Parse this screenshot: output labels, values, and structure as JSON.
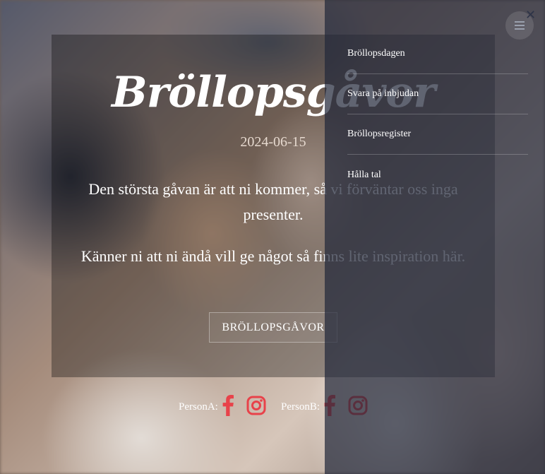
{
  "hero": {
    "title": "Bröllopsgåvor",
    "date": "2024-06-15",
    "paragraph_1": "Den största gåvan är att ni kommer, så vi förväntar oss inga presenter.",
    "paragraph_2": "Känner ni att ni ändå vill ge något så finns lite inspiration här.",
    "button_label": "BRÖLLOPSGÅVOR"
  },
  "social": {
    "person_a_label": "PersonA:",
    "person_b_label": "PersonB:",
    "icons": [
      "facebook-icon",
      "instagram-icon"
    ],
    "accent_color": "#e8424a"
  },
  "nav": {
    "items": [
      {
        "label": "Bröllopsdagen"
      },
      {
        "label": "Svara på inbjudan"
      },
      {
        "label": "Bröllopsregister"
      },
      {
        "label": "Hålla tal"
      }
    ],
    "close_symbol": "✕",
    "toggle_icon": "hamburger-icon",
    "panel_color": "#23283a"
  }
}
